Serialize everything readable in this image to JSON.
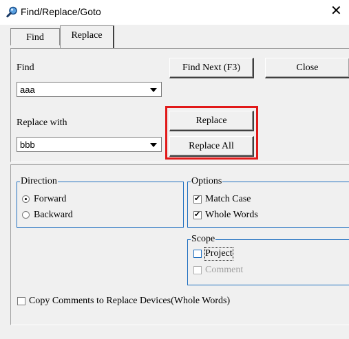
{
  "window": {
    "title": "Find/Replace/Goto",
    "close_glyph": "✕",
    "icon": "search-icon"
  },
  "tabs": [
    {
      "label": "Find",
      "active": false
    },
    {
      "label": "Replace",
      "active": true
    }
  ],
  "find": {
    "label": "Find",
    "value": "aaa"
  },
  "replace_with": {
    "label": "Replace with",
    "value": "bbb"
  },
  "buttons": {
    "find_next": "Find Next (F3)",
    "close": "Close",
    "replace": "Replace",
    "replace_all": "Replace All"
  },
  "highlight_color": "#e11919",
  "direction": {
    "title": "Direction",
    "options": [
      {
        "label": "Forward",
        "selected": true
      },
      {
        "label": "Backward",
        "selected": false
      }
    ]
  },
  "options": {
    "title": "Options",
    "items": [
      {
        "label": "Match Case",
        "checked": true
      },
      {
        "label": "Whole Words",
        "checked": true
      }
    ]
  },
  "scope": {
    "title": "Scope",
    "items": [
      {
        "label": "Project",
        "checked": false,
        "enabled": true
      },
      {
        "label": "Comment",
        "checked": false,
        "enabled": false
      }
    ]
  },
  "copy_comments": {
    "label": "Copy Comments to Replace Devices(Whole Words)",
    "checked": false
  },
  "colors": {
    "group_border": "#1f6fc0",
    "background": "#f0f0f0"
  }
}
